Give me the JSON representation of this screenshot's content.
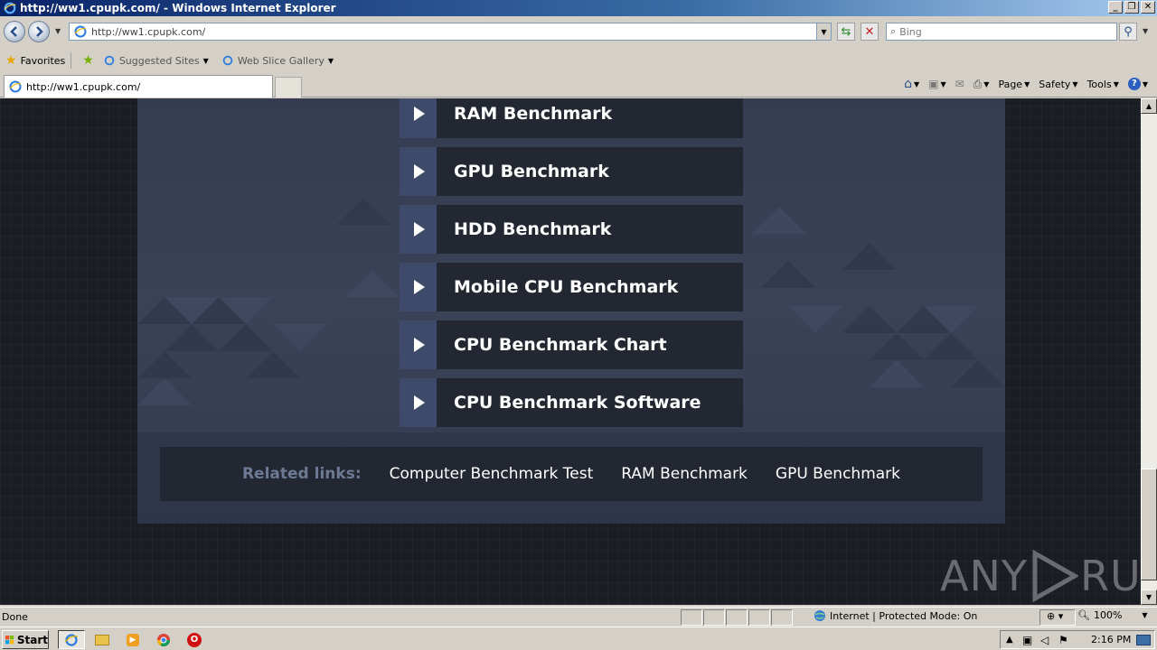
{
  "window": {
    "title": "http://ww1.cpupk.com/ - Windows Internet Explorer"
  },
  "address_bar": {
    "url": "http://ww1.cpupk.com/"
  },
  "search": {
    "placeholder": "Bing"
  },
  "favorites_bar": {
    "favorites_label": "Favorites",
    "items": [
      "Suggested Sites",
      "Web Slice Gallery"
    ]
  },
  "tab": {
    "title": "http://ww1.cpupk.com/"
  },
  "command_bar": {
    "page_label": "Page",
    "safety_label": "Safety",
    "tools_label": "Tools"
  },
  "page": {
    "bench_items": [
      "RAM Benchmark",
      "GPU Benchmark",
      "HDD Benchmark",
      "Mobile CPU Benchmark",
      "CPU Benchmark Chart",
      "CPU Benchmark Software"
    ],
    "related": {
      "label": "Related links:",
      "links": [
        "Computer Benchmark Test",
        "RAM Benchmark",
        "GPU Benchmark"
      ]
    }
  },
  "watermark": {
    "left": "ANY",
    "right": "RUN"
  },
  "status_bar": {
    "status": "Done",
    "zone": "Internet | Protected Mode: On",
    "zoom": "100%"
  },
  "taskbar": {
    "start_label": "Start",
    "clock": "2:16 PM"
  },
  "colors": {
    "page_bg": "#1a1d24",
    "panel_bg": "#3a4258",
    "item_icon_bg": "#3e4a6a",
    "item_label_bg": "#222731",
    "related_label": "#6d7a94"
  }
}
